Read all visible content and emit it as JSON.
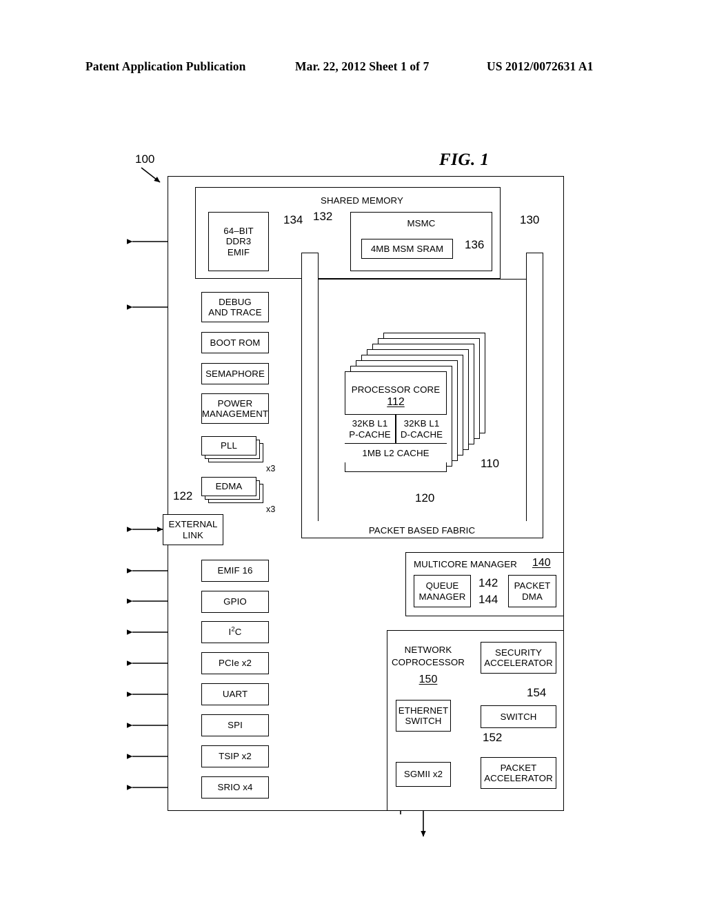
{
  "header": {
    "publication": "Patent Application Publication",
    "date_sheet": "Mar. 22, 2012  Sheet 1 of 7",
    "number": "US 2012/0072631 A1"
  },
  "figure": {
    "label": "FIG. 1",
    "system_ref": "100"
  },
  "shared_memory": {
    "title": "SHARED MEMORY",
    "ref": "130",
    "ddr3": {
      "line1": "64–BIT",
      "line2": "DDR3",
      "line3": "EMIF",
      "ref": "134"
    },
    "msmc": {
      "title": "MSMC",
      "ref": "132"
    },
    "sram": {
      "label": "4MB MSM SRAM",
      "ref": "136"
    }
  },
  "fabric": {
    "label": "PACKET BASED FABRIC",
    "ref": "120"
  },
  "core": {
    "title": "PROCESSOR CORE",
    "core_ref": "112",
    "stack_ref": "110",
    "l1p": {
      "line1": "32KB L1",
      "line2": "P-CACHE"
    },
    "l1d": {
      "line1": "32KB L1",
      "line2": "D-CACHE"
    },
    "l2": "1MB L2 CACHE"
  },
  "left_top_blocks": [
    {
      "name": "debug-and-trace",
      "line1": "DEBUG",
      "line2": "AND TRACE",
      "multi": false,
      "mult": ""
    },
    {
      "name": "boot-rom",
      "line1": "BOOT ROM",
      "line2": "",
      "multi": false,
      "mult": ""
    },
    {
      "name": "semaphore",
      "line1": "SEMAPHORE",
      "line2": "",
      "multi": false,
      "mult": ""
    },
    {
      "name": "power-management",
      "line1": "POWER",
      "line2": "MANAGEMENT",
      "multi": false,
      "mult": ""
    },
    {
      "name": "pll",
      "line1": "PLL",
      "line2": "",
      "multi": true,
      "mult": "x3"
    },
    {
      "name": "edma",
      "line1": "EDMA",
      "line2": "",
      "multi": true,
      "mult": "x3"
    }
  ],
  "external_link": {
    "line1": "EXTERNAL",
    "line2": "LINK",
    "ref": "122"
  },
  "peripherals": [
    {
      "name": "emif-16",
      "label": "EMIF 16"
    },
    {
      "name": "gpio",
      "label": "GPIO"
    },
    {
      "name": "i2c",
      "label": "I2C",
      "html": true
    },
    {
      "name": "pcie-x2",
      "label": "PCIe x2"
    },
    {
      "name": "uart",
      "label": "UART"
    },
    {
      "name": "spi",
      "label": "SPI"
    },
    {
      "name": "tsip-x2",
      "label": "TSIP x2"
    },
    {
      "name": "srio-x4",
      "label": "SRIO x4"
    }
  ],
  "multicore_manager": {
    "title": "MULTICORE MANAGER",
    "ref": "140",
    "queue_manager": {
      "line1": "QUEUE",
      "line2": "MANAGER",
      "ref": "144"
    },
    "packet_dma": {
      "line1": "PACKET",
      "line2": "DMA",
      "ref": "142"
    }
  },
  "network_coprocessor": {
    "line1": "NETWORK",
    "line2": "COPROCESSOR",
    "ref": "150",
    "ethernet_switch": {
      "line1": "ETHERNET",
      "line2": "SWITCH"
    },
    "sgmii": {
      "label": "SGMII x2"
    },
    "security_accelerator": {
      "line1": "SECURITY",
      "line2": "ACCELERATOR",
      "ref": "154"
    },
    "switch": {
      "label": "SWITCH",
      "ref": "152"
    },
    "packet_accelerator": {
      "line1": "PACKET",
      "line2": "ACCELERATOR"
    }
  }
}
